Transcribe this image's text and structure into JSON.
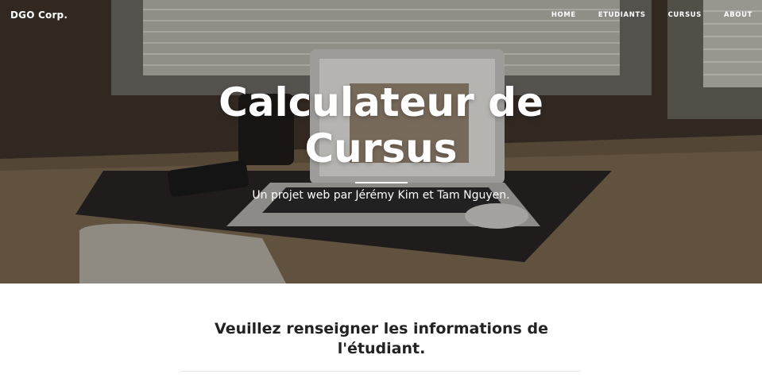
{
  "brand": "DGO Corp.",
  "nav": {
    "items": [
      "HOME",
      "ETUDIANTS",
      "CURSUS",
      "ABOUT"
    ]
  },
  "hero": {
    "title_line1": "Calculateur de",
    "title_line2": "Cursus",
    "subtitle": "Un projet web par Jérémy Kim et Tam Nguyen."
  },
  "form_section": {
    "title_line1": "Veuillez renseigner les informations de",
    "title_line2": "l'étudiant."
  },
  "colors": {
    "hero_text": "#ffffff",
    "section_title": "#222222"
  }
}
